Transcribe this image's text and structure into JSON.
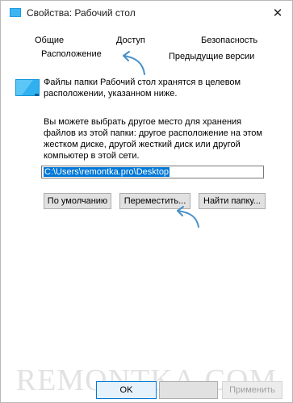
{
  "window": {
    "title": "Свойства: Рабочий стол",
    "close_glyph": "✕"
  },
  "tabs": {
    "common": "Общие",
    "access": "Доступ",
    "security": "Безопасность",
    "location": "Расположение",
    "previous_versions": "Предыдущие версии"
  },
  "location": {
    "info": "Файлы папки Рабочий стол хранятся в целевом расположении, указанном ниже.",
    "description": "Вы можете выбрать другое место для хранения файлов из этой папки: другое расположение на этом жестком диске, другой жесткий диск или другой компьютер в этой сети.",
    "path_value": "C:\\Users\\remontka.pro\\Desktop",
    "default_button": "По умолчанию",
    "move_button": "Переместить...",
    "find_folder_button": "Найти папку..."
  },
  "footer": {
    "ok": "OK",
    "cancel": "",
    "apply": "Применить"
  },
  "watermark": "REMONTKA.COM",
  "colors": {
    "accent": "#0078d7",
    "annotation_arrow": "#4a90c8",
    "watermark": "#e2e2e2"
  },
  "icons": {
    "title": "folder-icon",
    "folder": "desktop-folder-icon"
  }
}
